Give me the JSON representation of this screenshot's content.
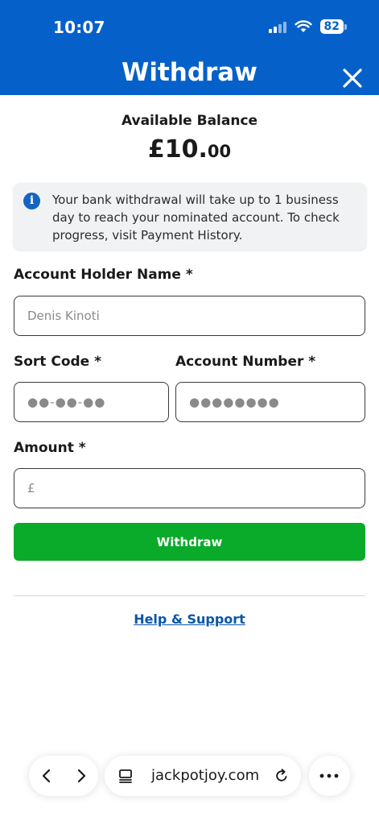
{
  "status_bar": {
    "time": "10:07",
    "battery": "82"
  },
  "header": {
    "title": "Withdraw"
  },
  "balance": {
    "label": "Available Balance",
    "amount_main": "£10.",
    "amount_cents": "00"
  },
  "info": {
    "text": "Your bank withdrawal will take up to 1 business day to reach your nominated account. To check progress, visit Payment History."
  },
  "form": {
    "account_holder": {
      "label": "Account Holder Name *",
      "placeholder": "Denis Kinoti"
    },
    "sort_code": {
      "label": "Sort Code *",
      "placeholder": "●●-●●-●●"
    },
    "account_number": {
      "label": "Account Number *",
      "placeholder": "●●●●●●●●"
    },
    "amount": {
      "label": "Amount *",
      "placeholder": "£"
    },
    "submit_label": "Withdraw"
  },
  "help": {
    "label": "Help & Support"
  },
  "browser": {
    "url": "jackpotjoy.com"
  },
  "colors": {
    "header": "#0561c9",
    "button": "#0aaa2a",
    "link": "#0b55a8"
  }
}
